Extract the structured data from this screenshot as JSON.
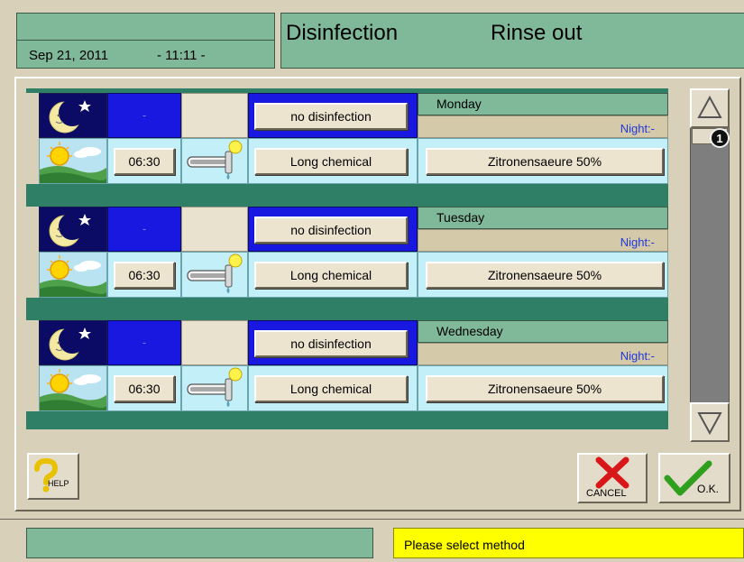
{
  "header": {
    "date": "Sep 21, 2011",
    "time": "- 11:11 -",
    "title_left": "Disinfection",
    "title_right": "Rinse out"
  },
  "days": [
    {
      "name": "Monday",
      "night_label": "Night:-",
      "night_time": "-",
      "disinfection_label": "no disinfection",
      "day_time": "06:30",
      "chemical_label": "Long chemical",
      "agent_label": "Zitronensaeure 50%"
    },
    {
      "name": "Tuesday",
      "night_label": "Night:-",
      "night_time": "-",
      "disinfection_label": "no disinfection",
      "day_time": "06:30",
      "chemical_label": "Long chemical",
      "agent_label": "Zitronensaeure 50%"
    },
    {
      "name": "Wednesday",
      "night_label": "Night:-",
      "night_time": "-",
      "disinfection_label": "no disinfection",
      "day_time": "06:30",
      "chemical_label": "Long chemical",
      "agent_label": "Zitronensaeure 50%"
    }
  ],
  "scroll": {
    "page": "1"
  },
  "buttons": {
    "help": "HELP",
    "cancel": "CANCEL",
    "ok": "O.K."
  },
  "status": {
    "message": "Please select method"
  },
  "colors": {
    "panel_green": "#80b89a",
    "night_blue": "#1818e0",
    "day_cyan": "#c3f0f8",
    "status_yellow": "#ffff00",
    "background": "#d8d0b8"
  },
  "icons": {
    "night": "moon-stars-icon",
    "day": "sun-landscape-icon",
    "temperature": "thermometer-drop-icon",
    "help": "question-mark-icon",
    "cancel": "red-x-icon",
    "ok": "green-check-icon"
  }
}
